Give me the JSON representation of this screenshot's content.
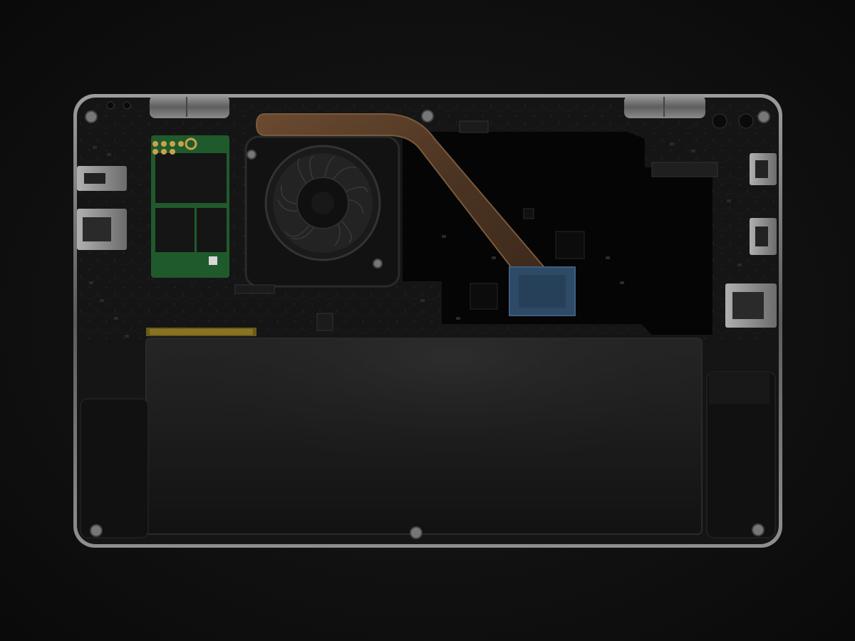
{
  "scene": {
    "subject": "laptop-bottom-internals",
    "colors": {
      "background": "#0f0f0f",
      "chassis_frame": "#8a8a8a",
      "chassis_inner": "#141414",
      "board": "#181818",
      "battery": "#1e1e1e",
      "heatpipe": "#5a3f2a",
      "ssd_green": "#1f5a2c",
      "cpu_blue": "#2d4a66",
      "ports": "#9a9a9a",
      "hinge": "#7d7d7d"
    }
  }
}
